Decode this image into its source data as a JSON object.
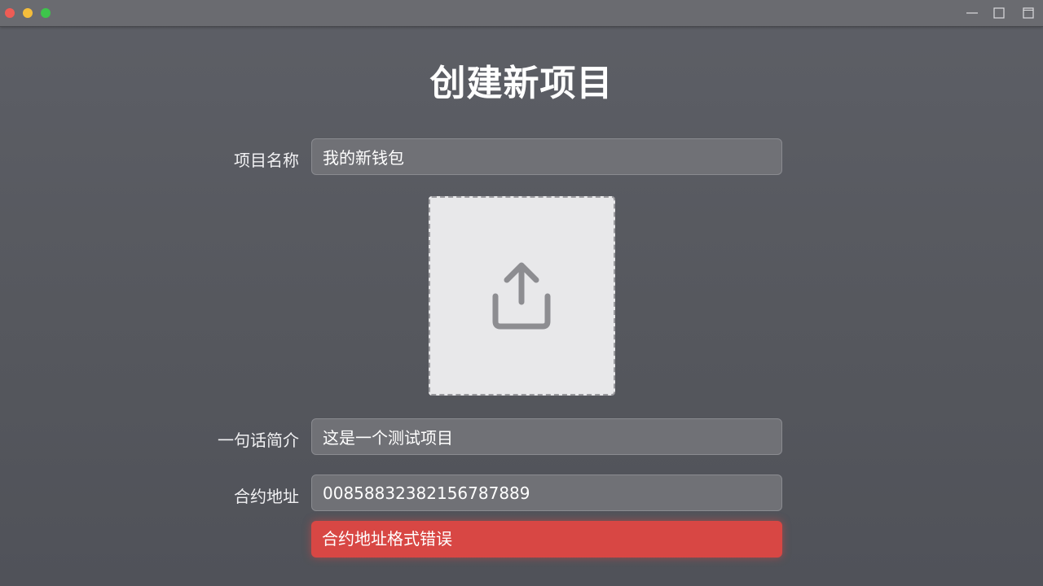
{
  "window": {
    "controls": [
      "minimize-icon",
      "maximize-icon",
      "restore-icon"
    ]
  },
  "page": {
    "title": "创建新项目"
  },
  "form": {
    "name": {
      "label": "项目名称",
      "value": "我的新钱包"
    },
    "upload": {
      "icon": "upload-icon"
    },
    "summary": {
      "label": "一句话简介",
      "value": "这是一个测试项目"
    },
    "contract": {
      "label": "合约地址",
      "value": "00858832382156787889",
      "error": "合约地址格式错误"
    }
  },
  "colors": {
    "background": "#56585f",
    "error": "#d84744",
    "field": "#707176"
  }
}
